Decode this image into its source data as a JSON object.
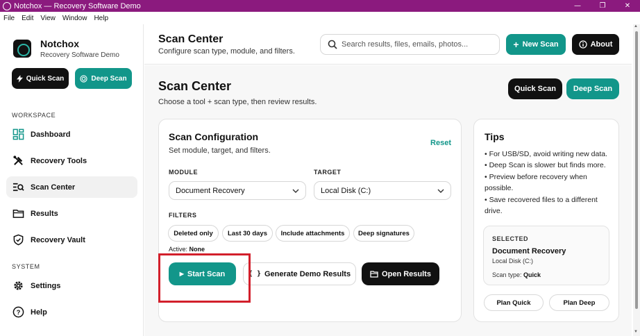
{
  "window": {
    "title": "Notchox — Recovery Software Demo"
  },
  "menu": [
    "File",
    "Edit",
    "View",
    "Window",
    "Help"
  ],
  "brand": {
    "name": "Notchox",
    "subtitle": "Recovery Software Demo"
  },
  "sidebar": {
    "quick_scan": "Quick Scan",
    "deep_scan": "Deep Scan",
    "workspace_label": "WORKSPACE",
    "system_label": "SYSTEM",
    "workspace_items": [
      {
        "label": "Dashboard",
        "icon": "dashboard-icon"
      },
      {
        "label": "Recovery Tools",
        "icon": "tools-icon"
      },
      {
        "label": "Scan Center",
        "icon": "scan-search-icon",
        "active": true
      },
      {
        "label": "Results",
        "icon": "folder-icon"
      },
      {
        "label": "Recovery Vault",
        "icon": "shield-icon"
      }
    ],
    "system_items": [
      {
        "label": "Settings",
        "icon": "gear-icon"
      },
      {
        "label": "Help",
        "icon": "help-icon"
      }
    ]
  },
  "topbar": {
    "title": "Scan Center",
    "subtitle": "Configure scan type, module, and filters.",
    "search_placeholder": "Search results, files, emails, photos...",
    "new_scan": "New Scan",
    "about": "About"
  },
  "header": {
    "title": "Scan Center",
    "subtitle": "Choose a tool + scan type, then review results.",
    "quick_scan": "Quick Scan",
    "deep_scan": "Deep Scan"
  },
  "config": {
    "title": "Scan Configuration",
    "subtitle": "Set module, target, and filters.",
    "reset": "Reset",
    "module_label": "MODULE",
    "module_value": "Document Recovery",
    "target_label": "TARGET",
    "target_value": "Local Disk (C:)",
    "filters_label": "FILTERS",
    "filters": [
      "Deleted only",
      "Last 30 days",
      "Include attachments",
      "Deep signatures"
    ],
    "active_prefix": "Active:",
    "active_value": "None",
    "start_scan": "Start Scan",
    "generate_demo": "Generate Demo Results",
    "open_results": "Open Results"
  },
  "tips": {
    "title": "Tips",
    "items": [
      "• For USB/SD, avoid writing new data.",
      "• Deep Scan is slower but finds more.",
      "• Preview before recovery when possible.",
      "• Save recovered files to a different drive."
    ],
    "selected_label": "SELECTED",
    "selected_module": "Document Recovery",
    "selected_target": "Local Disk (C:)",
    "scan_type_prefix": "Scan type:",
    "scan_type_value": "Quick",
    "plan_quick": "Plan Quick",
    "plan_deep": "Plan Deep"
  },
  "colors": {
    "titlebar": "#8b1a7e",
    "accent": "#12968a",
    "dark": "#111111",
    "highlight": "#d21f2b"
  }
}
